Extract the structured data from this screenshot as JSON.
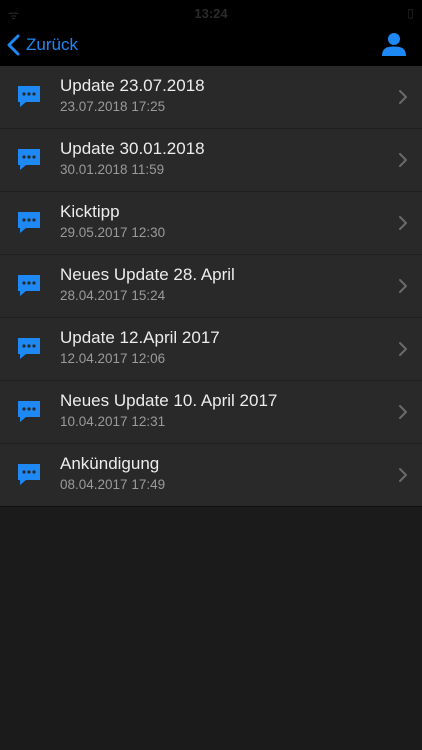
{
  "status_bar": {
    "left": "ᯤ ︎",
    "time": "13:24",
    "right": "▯"
  },
  "nav": {
    "back_label": "Zurück",
    "back_icon": "chevron-left-icon",
    "profile_icon": "person-icon"
  },
  "colors": {
    "accent": "#1e88f5",
    "background": "#1b1b1b",
    "row_background": "#292929",
    "navbar_background": "#000000"
  },
  "items": [
    {
      "title": "Update 23.07.2018",
      "date": "23.07.2018 17:25"
    },
    {
      "title": "Update 30.01.2018",
      "date": "30.01.2018 11:59"
    },
    {
      "title": "Kicktipp",
      "date": "29.05.2017 12:30"
    },
    {
      "title": "Neues Update 28. April",
      "date": "28.04.2017 15:24"
    },
    {
      "title": "Update 12.April 2017",
      "date": "12.04.2017 12:06"
    },
    {
      "title": "Neues Update 10. April 2017",
      "date": "10.04.2017 12:31"
    },
    {
      "title": "Ankündigung",
      "date": "08.04.2017 17:49"
    }
  ]
}
